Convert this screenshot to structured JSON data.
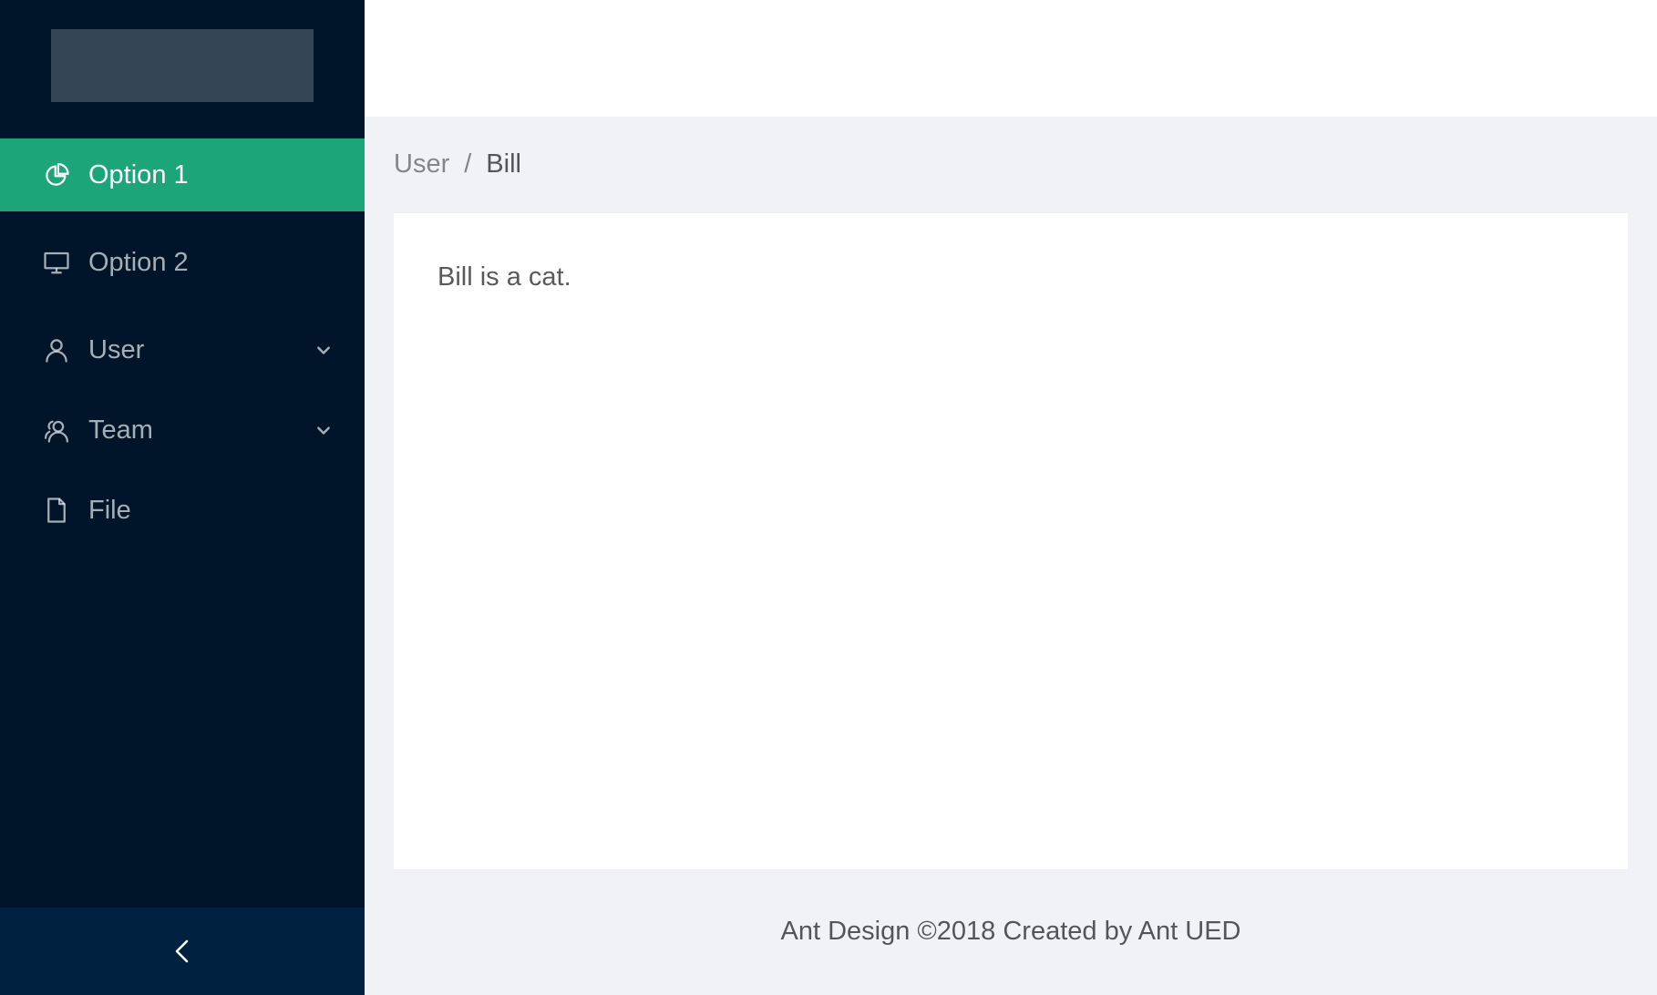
{
  "sidebar": {
    "items": [
      {
        "label": "Option 1",
        "icon": "pie-chart-icon",
        "selected": true
      },
      {
        "label": "Option 2",
        "icon": "desktop-icon",
        "selected": false
      },
      {
        "label": "User",
        "icon": "user-icon",
        "selected": false,
        "submenu": true
      },
      {
        "label": "Team",
        "icon": "team-icon",
        "selected": false,
        "submenu": true
      },
      {
        "label": "File",
        "icon": "file-icon",
        "selected": false
      }
    ],
    "collapse_icon": "chevron-left-icon"
  },
  "breadcrumb": {
    "items": [
      "User",
      "Bill"
    ],
    "separator": "/"
  },
  "content": {
    "text": "Bill is a cat."
  },
  "footer": {
    "text": "Ant Design ©2018 Created by Ant UED"
  },
  "colors": {
    "sider_bg": "#001529",
    "trigger_bg": "#002140",
    "selected_bg": "#1da57a",
    "main_bg": "#f0f2f5"
  }
}
